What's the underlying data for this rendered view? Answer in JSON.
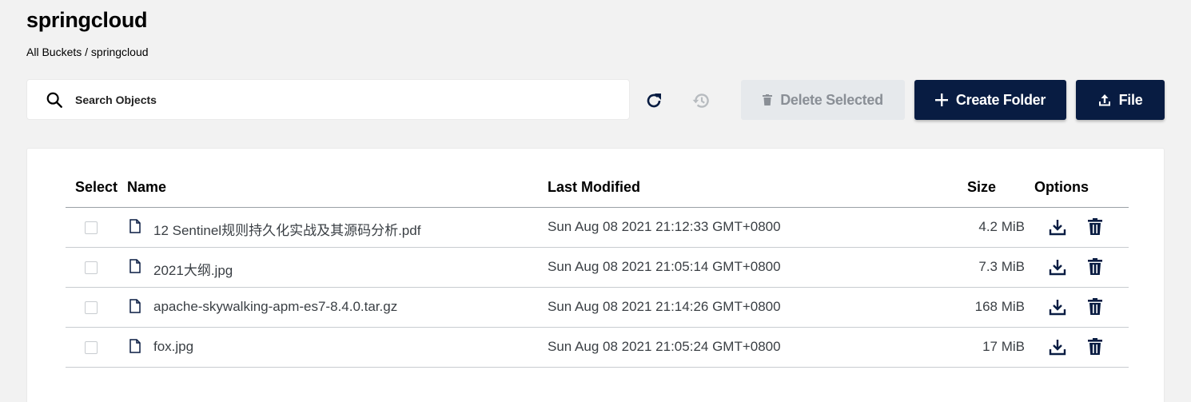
{
  "header": {
    "title": "springcloud",
    "breadcrumb": "All Buckets / springcloud"
  },
  "search": {
    "placeholder": "Search Objects",
    "value": ""
  },
  "toolbar": {
    "delete_label": "Delete Selected",
    "create_folder_label": "Create Folder",
    "upload_label": "File"
  },
  "table": {
    "columns": {
      "select": "Select",
      "name": "Name",
      "modified": "Last Modified",
      "size": "Size",
      "options": "Options"
    },
    "rows": [
      {
        "name": "12 Sentinel规则持久化实战及其源码分析.pdf",
        "modified": "Sun Aug 08 2021 21:12:33 GMT+0800",
        "size": "4.2 MiB"
      },
      {
        "name": "2021大纲.jpg",
        "modified": "Sun Aug 08 2021 21:05:14 GMT+0800",
        "size": "7.3 MiB"
      },
      {
        "name": "apache-skywalking-apm-es7-8.4.0.tar.gz",
        "modified": "Sun Aug 08 2021 21:14:26 GMT+0800",
        "size": "168 MiB"
      },
      {
        "name": "fox.jpg",
        "modified": "Sun Aug 08 2021 21:05:24 GMT+0800",
        "size": "17 MiB"
      }
    ]
  },
  "colors": {
    "primary": "#081c42",
    "disabled_bg": "#e6e9ec",
    "disabled_text": "#8a8f96"
  },
  "icons": [
    "search-icon",
    "refresh-icon",
    "history-icon",
    "trash-icon",
    "plus-icon",
    "upload-icon",
    "file-icon",
    "download-icon",
    "delete-icon"
  ]
}
